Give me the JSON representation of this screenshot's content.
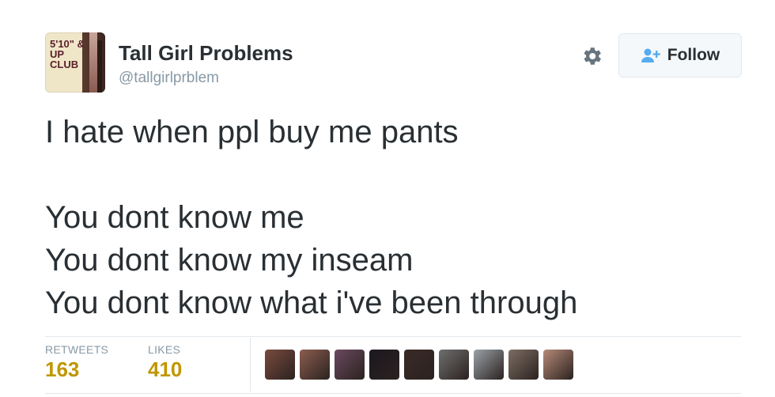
{
  "profile": {
    "avatar_text": "5'10\" & UP CLUB",
    "name": "Tall Girl Problems",
    "handle": "@tallgirlprblem"
  },
  "actions": {
    "settings_icon": "gear-icon",
    "follow_icon": "add-user-icon",
    "follow_label": "Follow"
  },
  "tweet": {
    "lines": [
      "I hate when ppl buy me pants",
      "",
      "You dont know me",
      "You dont know my inseam",
      "You dont know what i've been through"
    ]
  },
  "stats": {
    "retweets_label": "RETWEETS",
    "retweets_count": "163",
    "likes_label": "LIKES",
    "likes_count": "410"
  },
  "likers": {
    "count": 9,
    "colors": [
      "#7a4b3e",
      "#8c5d4f",
      "#6b4a60",
      "#1c1820",
      "#3a2a26",
      "#6f6f6f",
      "#9aa2a8",
      "#7d6e63",
      "#b78a78"
    ]
  },
  "colors": {
    "accent": "#55acee",
    "count": "#c09600",
    "muted": "#8899a6"
  }
}
